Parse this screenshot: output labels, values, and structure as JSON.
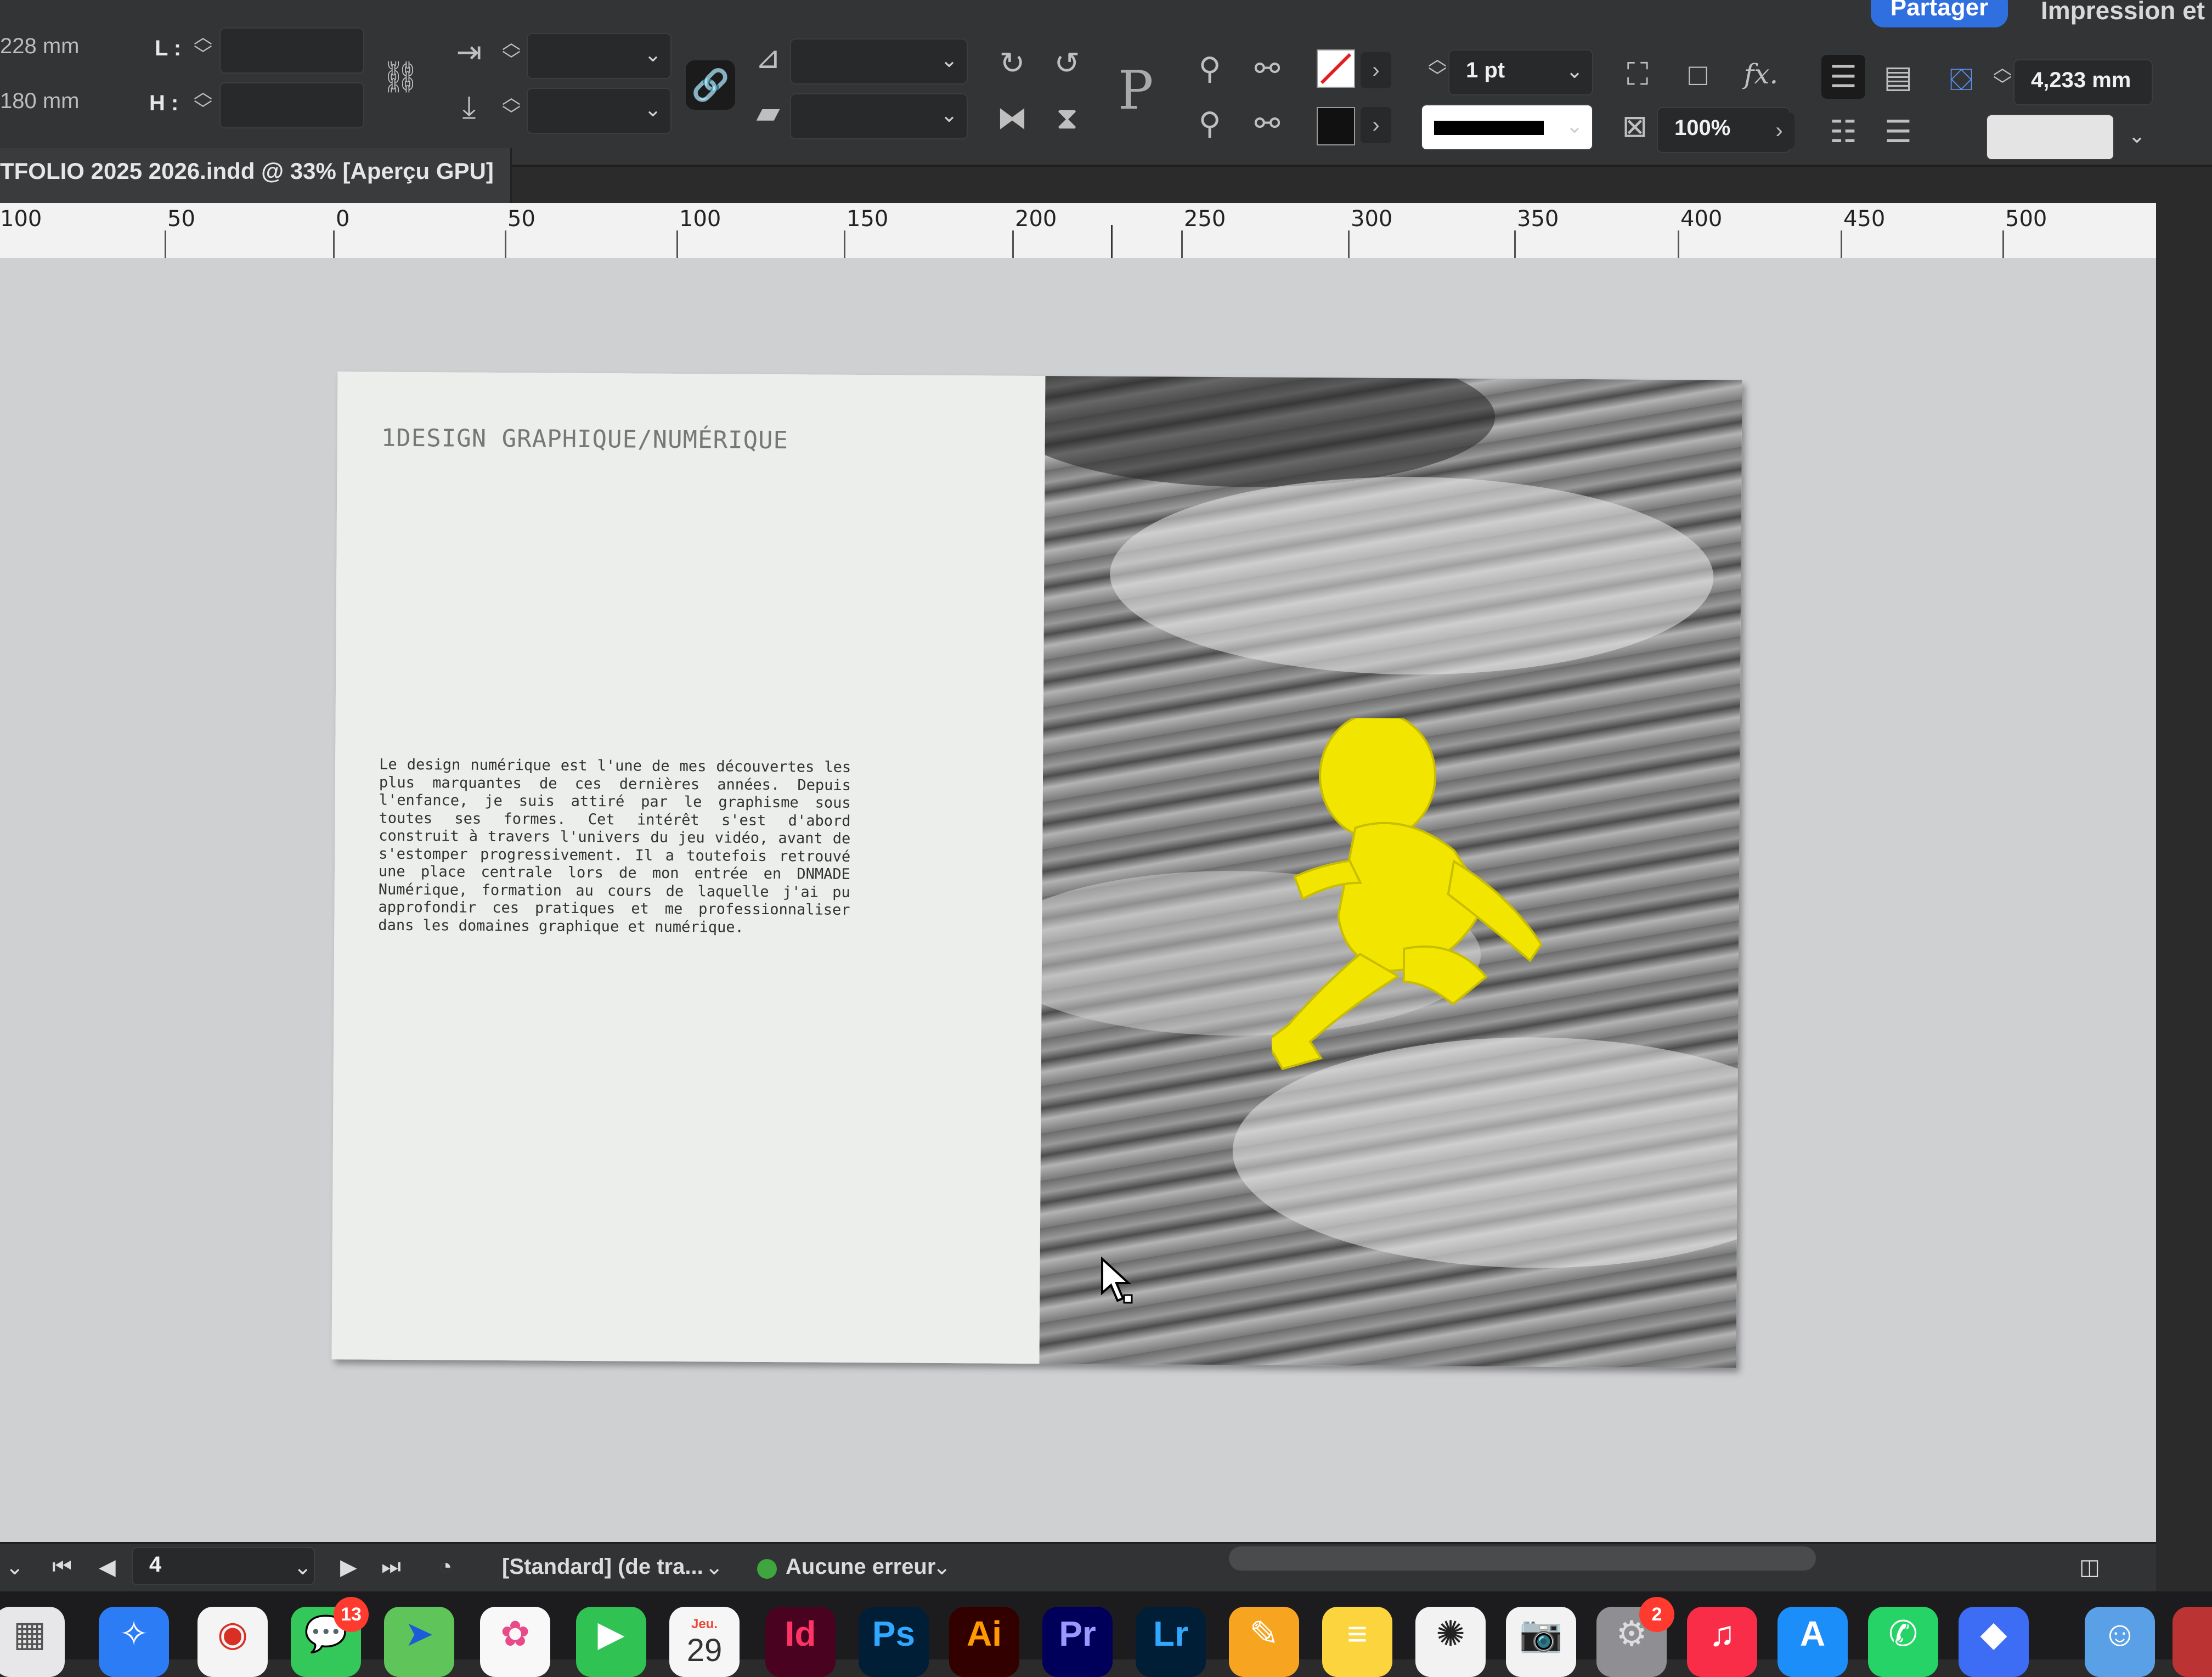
{
  "toolbar": {
    "ref_w": "228 mm",
    "ref_h": "180 mm",
    "label_l": "L :",
    "label_h": "H :",
    "stroke_weight": "1 pt",
    "opacity": "100%",
    "gap_value": "4,233 mm",
    "fx_label": "fx.",
    "share_label": "Partager",
    "print_label": "Impression et",
    "fill_color": "#ffffff",
    "stroke_color": "#000000"
  },
  "document": {
    "tab_title": "TFOLIO 2025 2026.indd @ 33% [Aperçu GPU]"
  },
  "ruler": {
    "labels": [
      "100",
      "50",
      "0",
      "50",
      "100",
      "150",
      "200",
      "250",
      "300",
      "350",
      "400",
      "450",
      "500"
    ]
  },
  "page": {
    "title": "1DESIGN GRAPHIQUE/NUMÉRIQUE",
    "body": "Le design numérique est l'une de mes découvertes les plus marquantes de ces dernières années. Depuis l'enfance, je suis attiré par le graphisme sous toutes ses formes. Cet intérêt s'est d'abord construit à travers l'univers du jeu vidéo, avant de s'estomper progressivement. Il a toutefois retrouvé une place centrale lors de mon entrée en DNMADE Numérique, formation au cours de laquelle j'ai pu approfondir ces pratiques et me professionnaliser dans les domaines graphique et numérique.",
    "photo_highlight_color": "#f2e600"
  },
  "status": {
    "page_number": "4",
    "style_label": "[Standard] (de tra...",
    "preflight_label": "Aucune erreur"
  },
  "dock": {
    "messages_badge": "13",
    "calendar_day": "Jeu.",
    "calendar_date": "29",
    "settings_badge": "2",
    "apps": [
      "Launchpad",
      "Safari",
      "Chrome",
      "Messages",
      "Plans",
      "Photos",
      "FaceTime",
      "Calendrier",
      "InDesign",
      "Photoshop",
      "Illustrator",
      "Premiere Pro",
      "Lightroom",
      "Pages",
      "Notes",
      "ChatGPT",
      "Capture",
      "Réglages",
      "Musique",
      "App Store",
      "WhatsApp",
      "Roblox",
      "Finder"
    ],
    "labels": {
      "id": "Id",
      "ps": "Ps",
      "ai": "Ai",
      "pr": "Pr",
      "lr": "Lr"
    }
  }
}
